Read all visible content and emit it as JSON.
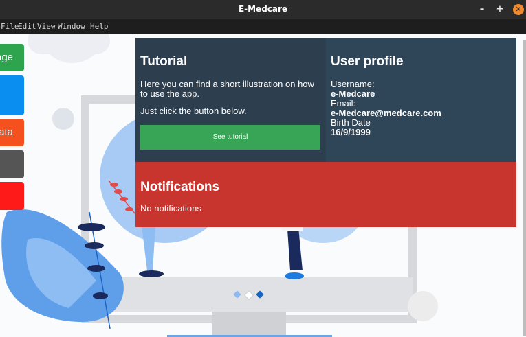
{
  "window": {
    "title": "E-Medcare",
    "minimize_glyph": "–",
    "maximize_glyph": "+",
    "close_glyph": "✕"
  },
  "menu": {
    "items": [
      "File",
      "Edit",
      "View",
      "Window",
      "Help"
    ]
  },
  "sidebar": {
    "items": [
      {
        "label": "age",
        "color": "#2ea44f"
      },
      {
        "label": "",
        "color": "#0a8ff0"
      },
      {
        "label": "ata",
        "color": "#f4511e"
      },
      {
        "label": "",
        "color": "#555555"
      },
      {
        "label": "",
        "color": "#ff1a1a"
      }
    ]
  },
  "tutorial": {
    "heading": "Tutorial",
    "description": "Here you can find a short illustration on how to use the app.",
    "instruction": "Just click the button below.",
    "button_label": "See tutorial"
  },
  "profile": {
    "heading": "User profile",
    "username_label": "Username:",
    "username": "e-Medcare",
    "email_label": "Email:",
    "email": "e-Medcare@medcare.com",
    "birth_label": "Birth Date",
    "birth_date": "16/9/1999"
  },
  "notifications": {
    "heading": "Notifications",
    "message": "No notifications"
  },
  "carousel": {
    "slide_count": 3,
    "active_index": 2
  },
  "colors": {
    "tutorial_bg": "#2d3e4f",
    "profile_bg": "#2f4558",
    "notifications_bg": "#c8352f",
    "tutorial_button": "#38a556"
  }
}
